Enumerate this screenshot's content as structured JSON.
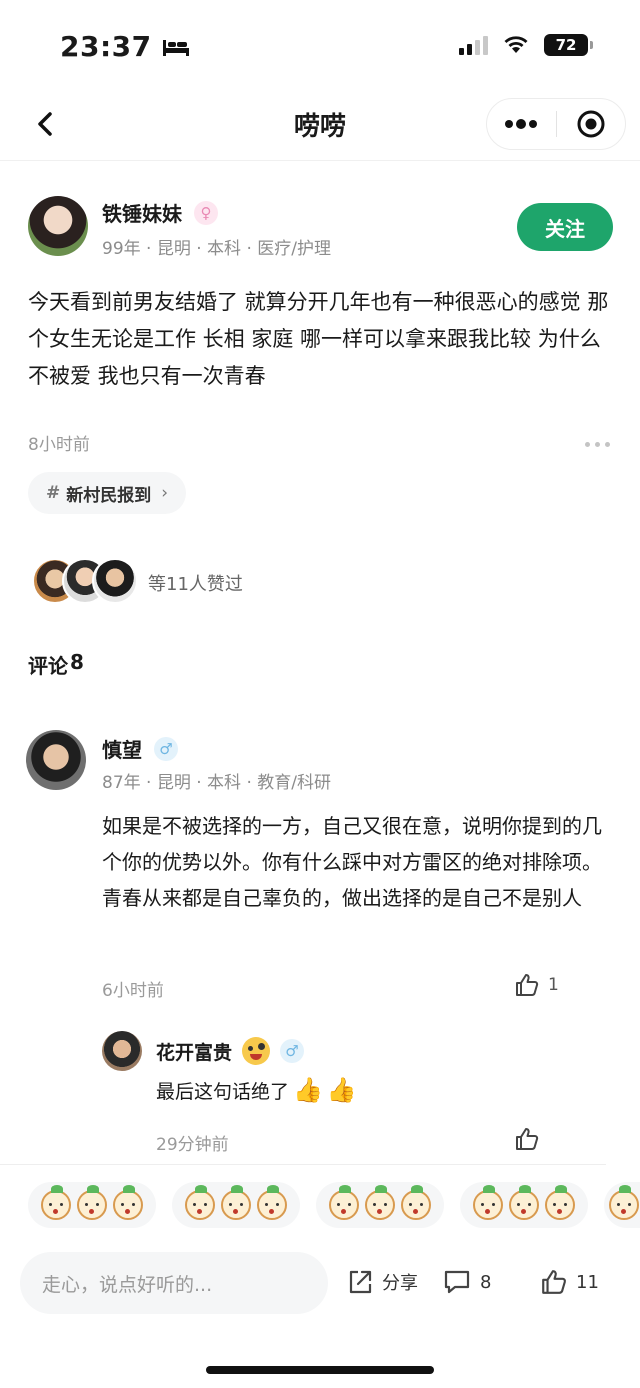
{
  "status_bar": {
    "time": "23:37",
    "battery": "72"
  },
  "nav": {
    "title": "唠唠"
  },
  "post": {
    "author": {
      "name": "铁锤妹妹",
      "gender_symbol": "♀",
      "meta": "99年 · 昆明 · 本科 · 医疗/护理"
    },
    "follow_label": "关注",
    "content": "今天看到前男友结婚了 就算分开几年也有一种很恶心的感觉 那个女生无论是工作 长相 家庭 哪一样可以拿来跟我比较 为什么不被爱 我也只有一次青春",
    "time": "8小时前",
    "topic": {
      "hash": "#",
      "label": "新村民报到",
      "chevron": "›"
    },
    "likers_text": "等11人赞过"
  },
  "comments": {
    "title_label": "评论",
    "count": "8",
    "items": [
      {
        "name": "慎望",
        "gender_symbol": "♂",
        "meta": "87年 · 昆明 · 本科 · 教育/科研",
        "content": "如果是不被选择的一方，自己又很在意，说明你提到的几个你的优势以外。你有什么踩中对方雷区的绝对排除项。青春从来都是自己辜负的，做出选择的是自己不是别人",
        "time": "6小时前",
        "like_count": "1",
        "reply": {
          "name": "花开富贵",
          "gender_symbol": "♂",
          "content": "最后这句话绝了",
          "time": "29分钟前"
        }
      }
    ]
  },
  "bottom_bar": {
    "input_placeholder": "走心，说点好听的...",
    "share_label": "分享",
    "comment_count": "8",
    "like_count": "11"
  },
  "colors": {
    "accent": "#1ea56b",
    "muted": "#8c8c8c"
  }
}
